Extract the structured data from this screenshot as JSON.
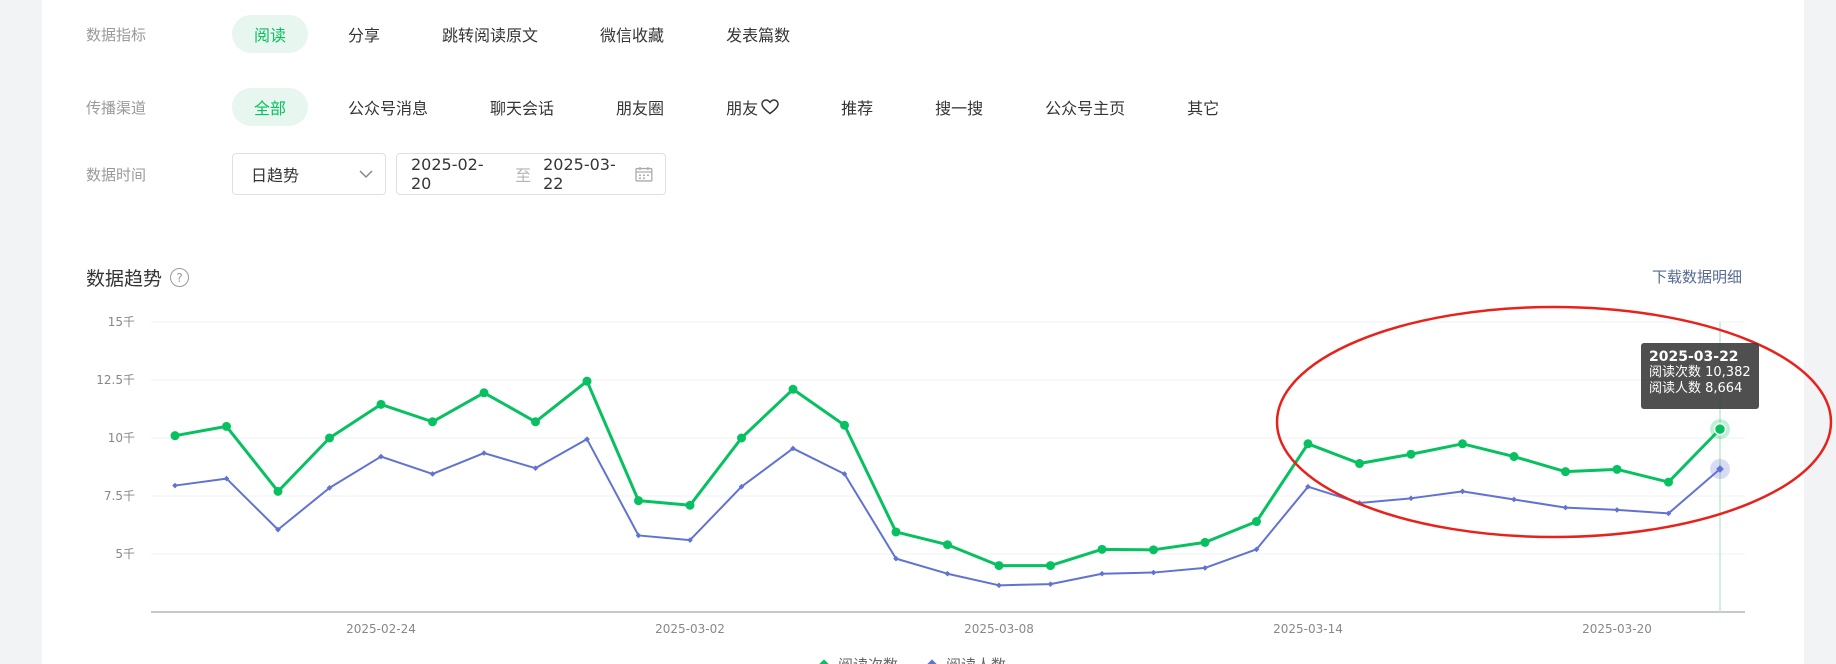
{
  "filters": {
    "metric": {
      "label": "数据指标",
      "options": [
        "阅读",
        "分享",
        "跳转阅读原文",
        "微信收藏",
        "发表篇数"
      ],
      "active": 0
    },
    "channel": {
      "label": "传播渠道",
      "options": [
        "全部",
        "公众号消息",
        "聊天会话",
        "朋友圈",
        "朋友",
        "推荐",
        "搜一搜",
        "公众号主页",
        "其它"
      ],
      "active": 0
    },
    "time": {
      "label": "数据时间",
      "mode": "日趋势",
      "start": "2025-02-20",
      "separator": "至",
      "end": "2025-03-22"
    }
  },
  "section": {
    "title": "数据趋势",
    "help_icon": "question-circle-icon",
    "help_text": "?",
    "download_label": "下载数据明细"
  },
  "tooltip": {
    "date": "2025-03-22",
    "line1": "阅读次数 10,382",
    "line2": "阅读人数 8,664"
  },
  "colors": {
    "accent": "#07c160",
    "series_reads": "#07c160",
    "series_readers": "#6173d2",
    "annotation": "#e8221b",
    "link": "#576b95"
  },
  "chart_data": {
    "type": "line",
    "x": [
      "2025-02-20",
      "2025-02-21",
      "2025-02-22",
      "2025-02-23",
      "2025-02-24",
      "2025-02-25",
      "2025-02-26",
      "2025-02-27",
      "2025-02-28",
      "2025-03-01",
      "2025-03-02",
      "2025-03-03",
      "2025-03-04",
      "2025-03-05",
      "2025-03-06",
      "2025-03-07",
      "2025-03-08",
      "2025-03-09",
      "2025-03-10",
      "2025-03-11",
      "2025-03-12",
      "2025-03-13",
      "2025-03-14",
      "2025-03-15",
      "2025-03-16",
      "2025-03-17",
      "2025-03-18",
      "2025-03-19",
      "2025-03-20",
      "2025-03-21",
      "2025-03-22"
    ],
    "x_ticks": [
      "2025-02-24",
      "2025-03-02",
      "2025-03-08",
      "2025-03-14",
      "2025-03-20"
    ],
    "y_ticks": [
      5000,
      7500,
      10000,
      12500,
      15000
    ],
    "y_tick_labels": [
      "5千",
      "7.5千",
      "10千",
      "12.5千",
      "15千"
    ],
    "ylim": [
      2500,
      15000
    ],
    "grid": true,
    "legend_position": "bottom",
    "series": [
      {
        "name": "阅读次数",
        "values": [
          10100,
          10500,
          7700,
          10000,
          11450,
          10700,
          11950,
          10700,
          12450,
          7300,
          7100,
          10000,
          12100,
          10550,
          5950,
          5400,
          4500,
          4500,
          5200,
          5180,
          5500,
          6400,
          9750,
          8900,
          9300,
          9750,
          9200,
          8550,
          8650,
          8100,
          10382
        ]
      },
      {
        "name": "阅读人数",
        "values": [
          7950,
          8250,
          6050,
          7850,
          9200,
          8450,
          9350,
          8700,
          9950,
          5800,
          5600,
          7900,
          9550,
          8450,
          4800,
          4150,
          3650,
          3700,
          4150,
          4200,
          4400,
          5200,
          7900,
          7200,
          7400,
          7700,
          7350,
          7000,
          6900,
          6750,
          8664
        ]
      }
    ]
  }
}
